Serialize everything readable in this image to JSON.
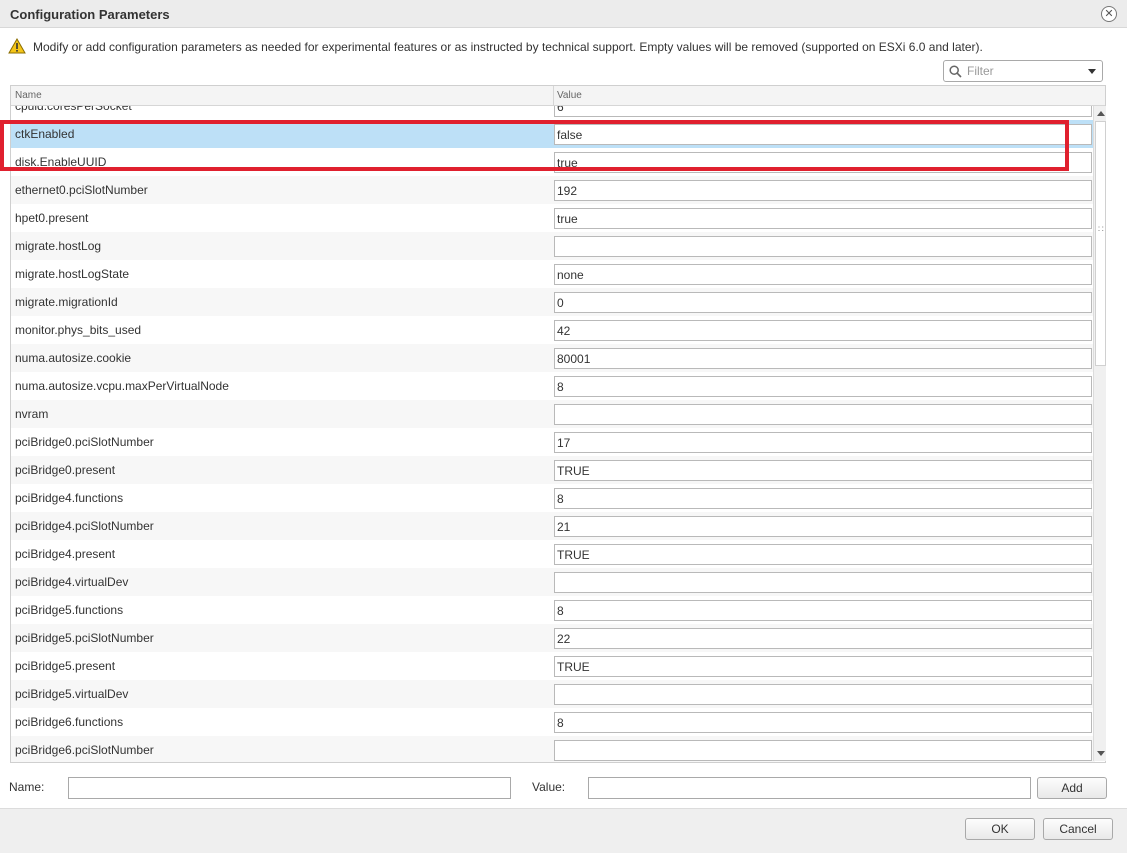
{
  "window": {
    "title": "Configuration Parameters",
    "close_glyph": "✕"
  },
  "warning": {
    "icon": "warning-triangle-icon",
    "text": "Modify or add configuration parameters as needed for experimental features or as instructed by technical support. Empty values will be removed (supported on ESXi 6.0 and later)."
  },
  "filter": {
    "placeholder": "Filter",
    "value": ""
  },
  "grid": {
    "columns": [
      "Name",
      "Value"
    ],
    "selected_index": 1,
    "rows": [
      {
        "name": "cpuid.coresPerSocket",
        "value": "6"
      },
      {
        "name": "ctkEnabled",
        "value": "false"
      },
      {
        "name": "disk.EnableUUID",
        "value": "true"
      },
      {
        "name": "ethernet0.pciSlotNumber",
        "value": "192"
      },
      {
        "name": "hpet0.present",
        "value": "true"
      },
      {
        "name": "migrate.hostLog",
        "value": ""
      },
      {
        "name": "migrate.hostLogState",
        "value": "none"
      },
      {
        "name": "migrate.migrationId",
        "value": "0"
      },
      {
        "name": "monitor.phys_bits_used",
        "value": "42"
      },
      {
        "name": "numa.autosize.cookie",
        "value": "80001"
      },
      {
        "name": "numa.autosize.vcpu.maxPerVirtualNode",
        "value": "8"
      },
      {
        "name": "nvram",
        "value": ""
      },
      {
        "name": "pciBridge0.pciSlotNumber",
        "value": "17"
      },
      {
        "name": "pciBridge0.present",
        "value": "TRUE"
      },
      {
        "name": "pciBridge4.functions",
        "value": "8"
      },
      {
        "name": "pciBridge4.pciSlotNumber",
        "value": "21"
      },
      {
        "name": "pciBridge4.present",
        "value": "TRUE"
      },
      {
        "name": "pciBridge4.virtualDev",
        "value": ""
      },
      {
        "name": "pciBridge5.functions",
        "value": "8"
      },
      {
        "name": "pciBridge5.pciSlotNumber",
        "value": "22"
      },
      {
        "name": "pciBridge5.present",
        "value": "TRUE"
      },
      {
        "name": "pciBridge5.virtualDev",
        "value": ""
      },
      {
        "name": "pciBridge6.functions",
        "value": "8"
      },
      {
        "name": "pciBridge6.pciSlotNumber",
        "value": ""
      }
    ]
  },
  "add_form": {
    "name_label": "Name:",
    "value_label": "Value:",
    "name_value": "",
    "value_value": "",
    "add_label": "Add"
  },
  "footer": {
    "ok_label": "OK",
    "cancel_label": "Cancel"
  },
  "colors": {
    "selected_row": "#bde0f7",
    "highlight_box": "#e0202e"
  }
}
